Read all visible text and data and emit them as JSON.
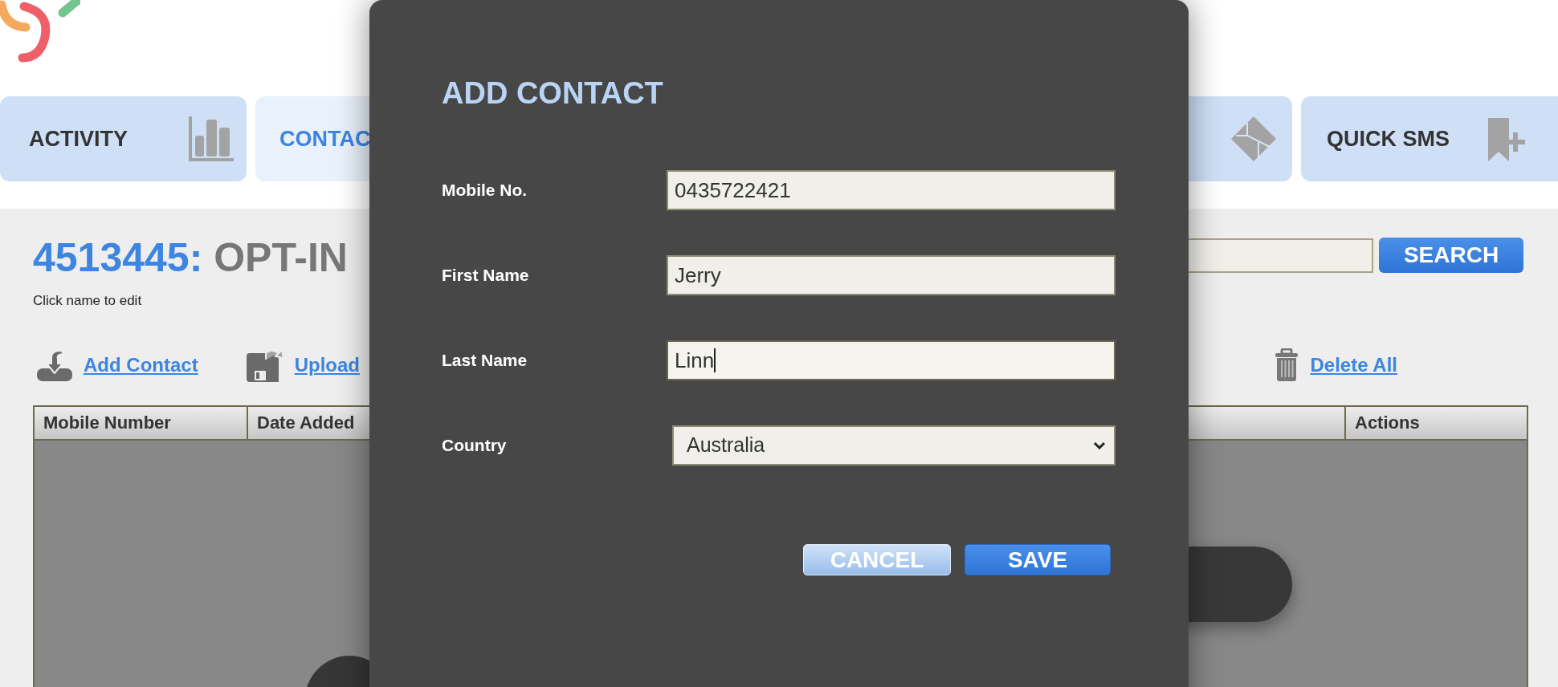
{
  "tabs": [
    {
      "label": "ACTIVITY",
      "selected": false
    },
    {
      "label": "CONTAC",
      "selected": true
    },
    {
      "selected": false
    },
    {
      "label": "QUICK SMS",
      "selected": false
    }
  ],
  "list_heading": {
    "number": "4513445:",
    "name": "OPT-IN"
  },
  "hint": "Click name to edit",
  "search": {
    "button": "SEARCH"
  },
  "actions": [
    {
      "label": "Add Contact",
      "kind": "add"
    },
    {
      "label": "Upload",
      "kind": "upload"
    },
    {
      "label": "Delete All",
      "kind": "delete"
    }
  ],
  "table": {
    "columns": [
      "Mobile Number",
      "Date Added",
      "Actions"
    ]
  },
  "dialog": {
    "title": "ADD CONTACT",
    "fields": [
      {
        "label": "Mobile No.",
        "kind": "text",
        "value": "0435722421",
        "focused": false
      },
      {
        "label": "First Name",
        "kind": "text",
        "value": "Jerry",
        "focused": false
      },
      {
        "label": "Last Name",
        "kind": "text",
        "value": "Linn",
        "focused": true
      },
      {
        "label": "Country",
        "kind": "select",
        "value": "Australia"
      }
    ],
    "buttons": [
      {
        "label": "CANCEL",
        "kind": "secondary"
      },
      {
        "label": "SAVE",
        "kind": "primary"
      }
    ]
  }
}
